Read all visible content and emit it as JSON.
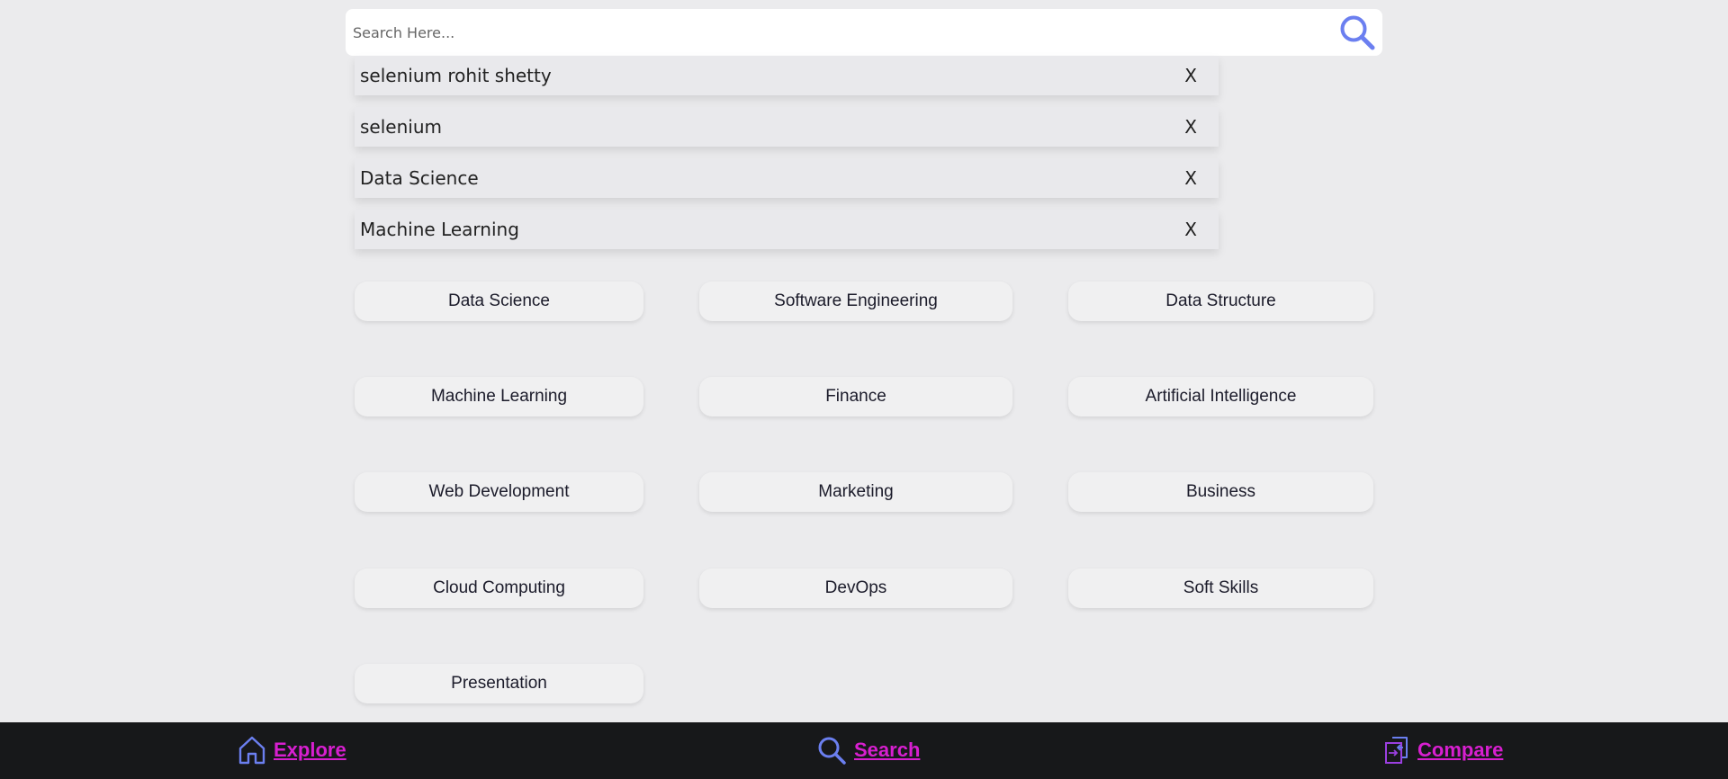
{
  "search": {
    "placeholder": "Search Here...",
    "icon": "search-icon"
  },
  "recent_searches": [
    {
      "text": "selenium rohit shetty",
      "remove_label": "X"
    },
    {
      "text": "selenium",
      "remove_label": "X"
    },
    {
      "text": "Data Science",
      "remove_label": "X"
    },
    {
      "text": "Machine Learning",
      "remove_label": "X"
    }
  ],
  "categories": [
    "Data Science",
    "Software Engineering",
    "Data Structure",
    "Machine Learning",
    "Finance",
    "Artificial Intelligence",
    "Web Development",
    "Marketing",
    "Business",
    "Cloud Computing",
    "DevOps",
    "Soft Skills",
    "Presentation"
  ],
  "bottom_nav": {
    "explore": {
      "label": "Explore",
      "icon": "home-icon"
    },
    "search": {
      "label": "Search",
      "icon": "search-icon"
    },
    "compare": {
      "label": "Compare",
      "icon": "compare-icon"
    }
  },
  "colors": {
    "accent_icon": "#6b7ff0",
    "nav_link": "#d81fd0",
    "nav_bg": "#17181a",
    "page_bg": "#ebebed"
  }
}
